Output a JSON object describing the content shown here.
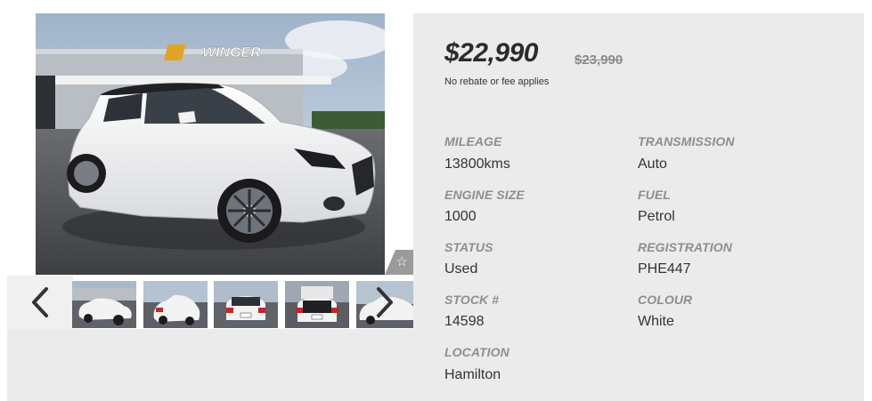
{
  "listing": {
    "price": "$22,990",
    "original_price": "$23,990",
    "price_note": "No rebate or fee applies"
  },
  "gallery": {
    "favorite_icon": "star-outline-icon",
    "thumbnail_count": 5,
    "prev_icon": "chevron-left-icon",
    "next_icon": "chevron-right-icon"
  },
  "specs": {
    "mileage": {
      "label": "MILEAGE",
      "value": "13800kms"
    },
    "transmission": {
      "label": "TRANSMISSION",
      "value": "Auto"
    },
    "engine_size": {
      "label": "ENGINE SIZE",
      "value": "1000"
    },
    "fuel": {
      "label": "FUEL",
      "value": "Petrol"
    },
    "status": {
      "label": "STATUS",
      "value": "Used"
    },
    "registration": {
      "label": "REGISTRATION",
      "value": "PHE447"
    },
    "stock": {
      "label": "STOCK #",
      "value": "14598"
    },
    "colour": {
      "label": "COLOUR",
      "value": "White"
    },
    "location": {
      "label": "LOCATION",
      "value": "Hamilton"
    }
  },
  "photo_signage": {
    "dealer_sign": "WINGER"
  },
  "colors": {
    "panel_bg": "#ebebeb",
    "label_gray": "#8e8e8e",
    "text_dark": "#333333"
  }
}
